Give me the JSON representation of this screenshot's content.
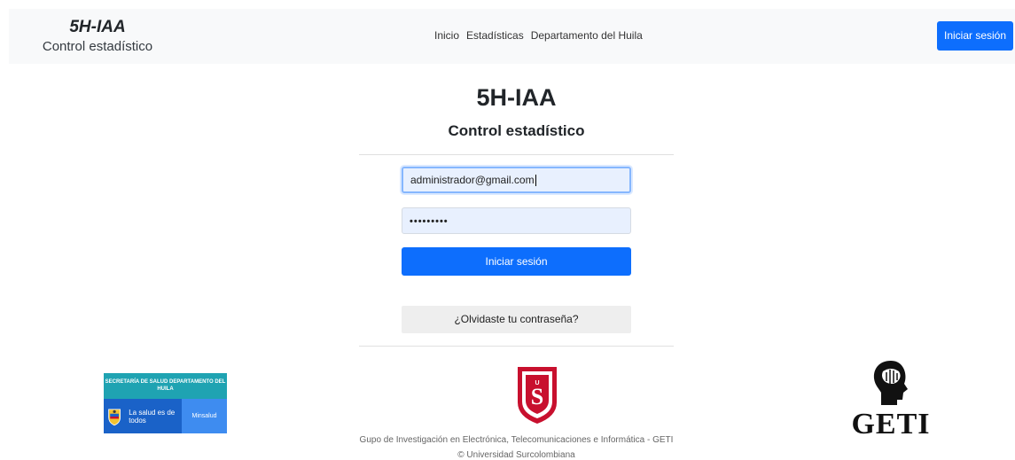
{
  "navbar": {
    "brand_title": "5H-IAA",
    "brand_subtitle": "Control estadístico",
    "links": [
      "Inicio",
      "Estadísticas",
      "Departamento del Huila"
    ],
    "login_button": "Iniciar sesión"
  },
  "main": {
    "title": "5H-IAA",
    "subtitle": "Control estadístico",
    "email_value": "administrador@gmail.com",
    "password_mask": "•••••••••",
    "login_button": "Iniciar sesión",
    "forgot_button": "¿Olvidaste tu contraseña?"
  },
  "footer": {
    "salud_logo_top": "SECRETARÍA DE SALUD DEPARTAMENTO DEL HUILA",
    "salud_logo_slogan": "La salud es de todos",
    "salud_logo_minsalud": "Minsalud",
    "usco_logo_letters": "US",
    "group_text": "Gupo de Investigación en Electrónica, Telecomunicaciones e Informática - GETI",
    "copyright": "© Universidad Surcolombiana",
    "geti_logo_text": "GETI"
  },
  "colors": {
    "primary": "#0d6efd",
    "navbar_bg": "#f8f9fa",
    "input_bg": "#e8f0fe",
    "usco_red": "#c8102e",
    "salud_teal": "#1fa3b2",
    "salud_blue": "#1a62c8"
  }
}
